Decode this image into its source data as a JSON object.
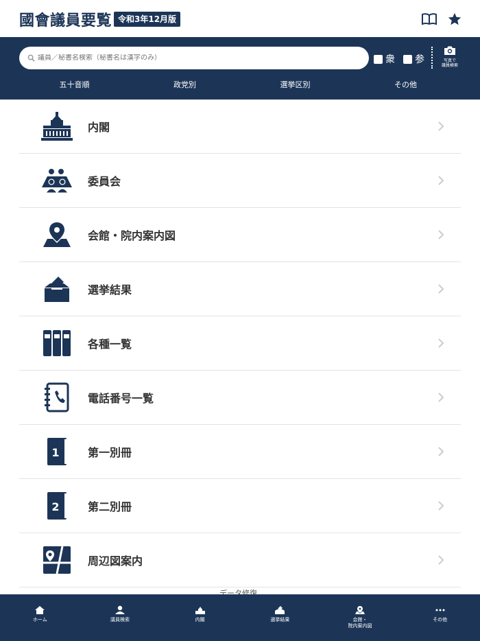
{
  "header": {
    "title": "國會議員要覧",
    "edition": "令和3年12月版"
  },
  "search": {
    "placeholder": "議員／秘書名検索（秘書名は漢字のみ）",
    "checkbox_shugiin": "衆",
    "checkbox_sangiin": "参",
    "photo_label": "写真で\n議員検索"
  },
  "tabs": [
    "五十音順",
    "政党別",
    "選挙区別",
    "その他"
  ],
  "menu": [
    {
      "label": "内閣",
      "icon": "diet-building-icon"
    },
    {
      "label": "委員会",
      "icon": "committee-icon"
    },
    {
      "label": "会館・院内案内図",
      "icon": "map-pin-icon"
    },
    {
      "label": "選挙結果",
      "icon": "ballot-box-icon"
    },
    {
      "label": "各種一覧",
      "icon": "binders-icon"
    },
    {
      "label": "電話番号一覧",
      "icon": "phone-book-icon"
    },
    {
      "label": "第一別冊",
      "icon": "book-1-icon"
    },
    {
      "label": "第二別冊",
      "icon": "book-2-icon"
    },
    {
      "label": "周辺図案内",
      "icon": "area-map-icon"
    }
  ],
  "data_note": "データ修復",
  "bottom_nav": [
    "ホーム",
    "議員検索",
    "内閣",
    "選挙結果",
    "会館・\n院内案内図",
    "その他"
  ],
  "colors": {
    "primary": "#1c3557",
    "background": "#ffffff",
    "divider": "#e3e3e3"
  }
}
